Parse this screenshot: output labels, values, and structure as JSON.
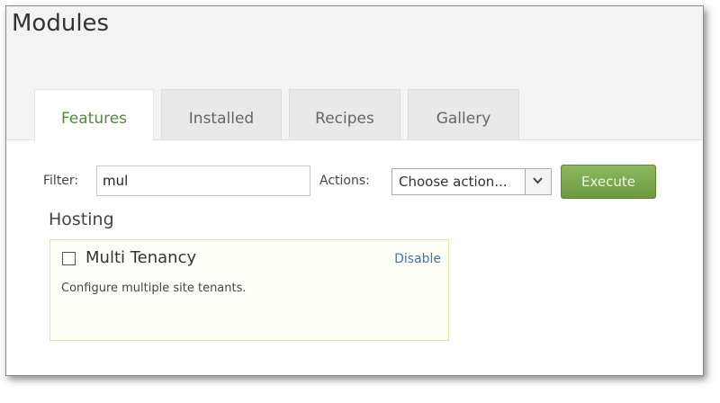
{
  "page": {
    "title": "Modules"
  },
  "tabs": [
    {
      "label": "Features",
      "active": true
    },
    {
      "label": "Installed",
      "active": false
    },
    {
      "label": "Recipes",
      "active": false
    },
    {
      "label": "Gallery",
      "active": false
    }
  ],
  "toolbar": {
    "filter_label": "Filter:",
    "filter_value": "mul",
    "actions_label": "Actions:",
    "actions_selected": "Choose action...",
    "execute_label": "Execute"
  },
  "section": {
    "heading": "Hosting",
    "features": [
      {
        "name": "Multi Tenancy",
        "checked": false,
        "action": "Disable",
        "description": "Configure multiple site tenants."
      }
    ]
  },
  "colors": {
    "active_tab_text": "#4d8a3a",
    "execute_button": "#7aa84e",
    "link": "#4c6f9a",
    "card_border": "#e2e6b0"
  }
}
